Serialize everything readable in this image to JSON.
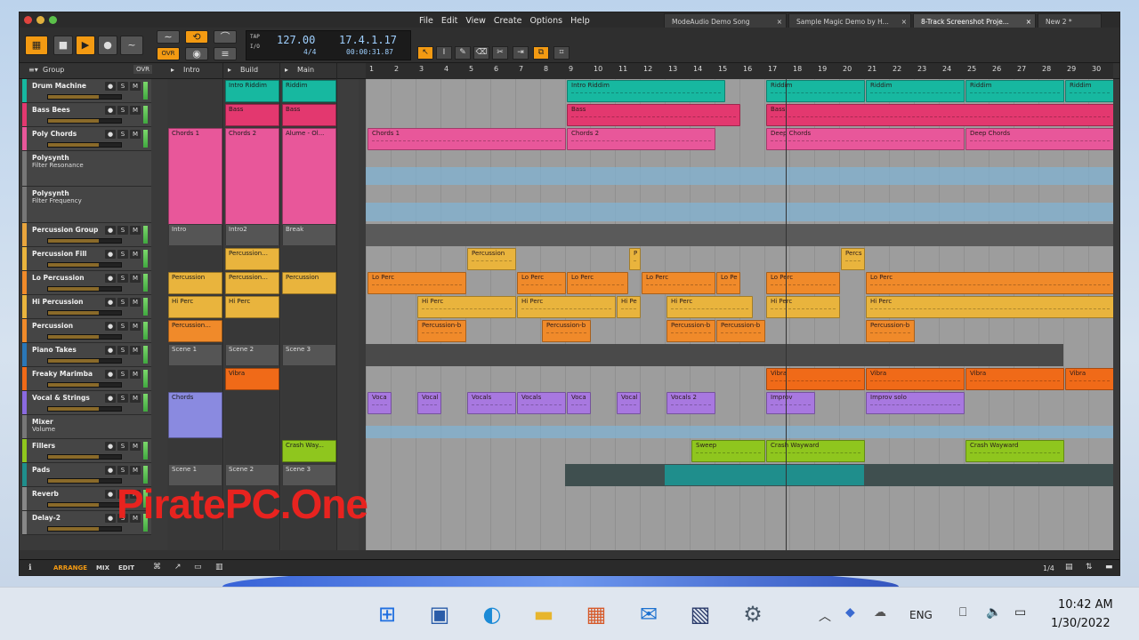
{
  "window": {
    "menu": [
      "File",
      "Edit",
      "View",
      "Create",
      "Options",
      "Help"
    ],
    "tabs": [
      {
        "label": "ModeAudio Demo Song",
        "active": false
      },
      {
        "label": "Sample Magic Demo by H...",
        "active": false
      },
      {
        "label": "8-Track Screenshot Proje...",
        "active": true
      },
      {
        "label": "New 2 *",
        "active": false
      }
    ]
  },
  "transport": {
    "tempo": "127.00",
    "signature": "4/4",
    "position": "17.4.1.17",
    "time": "00:00:31.87",
    "tap_label": "TAP",
    "io_label": "I/O",
    "ovr_label": "OVR"
  },
  "header": {
    "group_label": "Group",
    "ovr_label": "OVR"
  },
  "scenes": [
    "Intro",
    "Build",
    "Main"
  ],
  "ruler": [
    "1",
    "2",
    "3",
    "4",
    "5",
    "6",
    "7",
    "8",
    "9",
    "10",
    "11",
    "12",
    "13",
    "14",
    "15",
    "16",
    "17",
    "18",
    "19",
    "20",
    "21",
    "22",
    "23",
    "24",
    "25",
    "26",
    "27",
    "28",
    "29",
    "30"
  ],
  "tracks": [
    {
      "name": "Drum Machine",
      "color": "#17b8a0"
    },
    {
      "name": "Bass Bees",
      "color": "#e3386f"
    },
    {
      "name": "Poly Chords",
      "color": "#e8579a"
    },
    {
      "name": "Polysynth",
      "sub": "Filter Resonance",
      "color": "#777"
    },
    {
      "name": "Polysynth",
      "sub": "Filter Frequency",
      "color": "#777"
    },
    {
      "name": "Percussion Group",
      "color": "#e9a53d"
    },
    {
      "name": "Percussion Fill",
      "color": "#e9b43d"
    },
    {
      "name": "Lo Percussion",
      "color": "#f08a2a"
    },
    {
      "name": "Hi Percussion",
      "color": "#e9b43d"
    },
    {
      "name": "Percussion",
      "color": "#f08a2a"
    },
    {
      "name": "Piano Takes",
      "color": "#2a77b8"
    },
    {
      "name": "Freaky Marimba",
      "color": "#f06a18"
    },
    {
      "name": "Vocal & Strings",
      "color": "#8a6ae0"
    },
    {
      "name": "Mixer",
      "sub": "Volume",
      "color": "#777"
    },
    {
      "name": "Fillers",
      "color": "#8fc61e"
    },
    {
      "name": "Pads",
      "color": "#1f8e8c"
    },
    {
      "name": "Reverb",
      "color": "#888"
    },
    {
      "name": "Delay-2",
      "color": "#888"
    }
  ],
  "launcher_clips": {
    "drum": [
      "Intro Riddim",
      "Riddim"
    ],
    "bass": [
      "Bass",
      "Bass"
    ],
    "chords": [
      "Chords 1",
      "Chords 2",
      "Alume - Ol..."
    ],
    "group": [
      "Intro",
      "Intro2",
      "Break"
    ],
    "fill": [
      "Percussion..."
    ],
    "lo": [
      "Percussion",
      "Percussion...",
      "Percussion"
    ],
    "hi": [
      "Hi Perc",
      "Hi Perc"
    ],
    "perc": [
      "Percussion..."
    ],
    "piano": [
      "Scene 1",
      "Scene 2",
      "Scene 3"
    ],
    "marimba": [
      "Vibra"
    ],
    "vocal": [
      "Chords"
    ],
    "fillers": [
      "Crash Way..."
    ],
    "pads": [
      "Scene 1",
      "Scene 2",
      "Scene 3"
    ]
  },
  "arrangement_labels": {
    "drum": [
      "Intro Riddim",
      "Riddim",
      "Riddim",
      "Riddim",
      "Riddim"
    ],
    "bass": [
      "Bass",
      "Bass"
    ],
    "chords": [
      "Chords 1",
      "Chords 2",
      "Deep Chords",
      "Deep Chords"
    ],
    "fill": [
      "Percussion",
      "P",
      "Percs"
    ],
    "lo": [
      "Lo Perc",
      "Lo Perc",
      "Lo Perc",
      "Lo Perc",
      "Lo Pe",
      "Lo Perc",
      "Lo Perc"
    ],
    "hi": [
      "Hi Perc",
      "Hi Perc",
      "Hi Pe",
      "Hi Perc",
      "Hi Perc",
      "Hi Perc"
    ],
    "perc": [
      "Percussion-b",
      "Percussion-b",
      "Percussion-b",
      "Percussion-b",
      "Percussion-b"
    ],
    "marimba": [
      "Vibra",
      "Vibra",
      "Vibra",
      "Vibra"
    ],
    "vocal": [
      "Voca",
      "Vocal",
      "Vocals",
      "Vocals",
      "Voca",
      "Vocal",
      "Vocals 2",
      "Improv",
      "Improv solo"
    ],
    "fillers": [
      "Sweep",
      "Crash Wayward",
      "Crash Wayward"
    ]
  },
  "footer": {
    "tabs": [
      "ARRANGE",
      "MIX",
      "EDIT"
    ],
    "zoom": "1/4"
  },
  "watermark": "PiratePC.One",
  "taskbar": {
    "lang": "ENG",
    "time": "10:42 AM",
    "date": "1/30/2022"
  }
}
